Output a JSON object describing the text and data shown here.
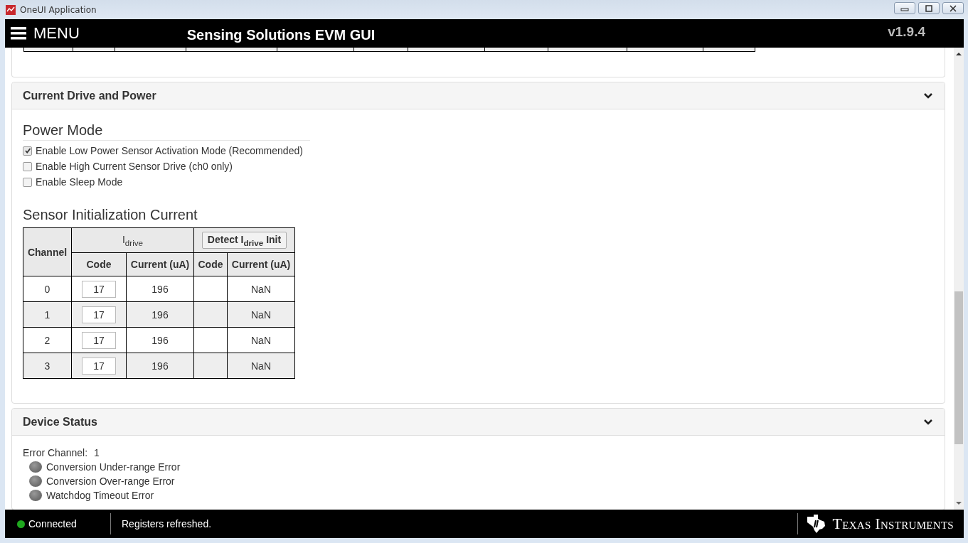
{
  "window": {
    "title": "OneUI Application"
  },
  "header": {
    "menu_label": "MENU",
    "title": "Sensing Solutions EVM GUI",
    "version": "v1.9.4"
  },
  "panels": [
    {
      "title": "Current Drive and Power",
      "expanded": true
    },
    {
      "title": "Device Status",
      "expanded": true
    }
  ],
  "power_mode": {
    "heading": "Power Mode",
    "options": [
      {
        "label": "Enable Low Power Sensor Activation Mode (Recommended)",
        "checked": true
      },
      {
        "label": "Enable High Current Sensor Drive (ch0 only)",
        "checked": false
      },
      {
        "label": "Enable Sleep Mode",
        "checked": false
      }
    ]
  },
  "init_current": {
    "heading": "Sensor Initialization Current",
    "channel_header": "Channel",
    "idrive_header": "I$_{drive}$",
    "detect_button": "Detect I$_{drive}$ Init",
    "columns": [
      "Code",
      "Current (uA)",
      "Code",
      "Current (uA)"
    ],
    "rows": [
      {
        "channel": "0",
        "code": "17",
        "current": "196",
        "detect_code": "",
        "detect_current": "NaN"
      },
      {
        "channel": "1",
        "code": "17",
        "current": "196",
        "detect_code": "",
        "detect_current": "NaN"
      },
      {
        "channel": "2",
        "code": "17",
        "current": "196",
        "detect_code": "",
        "detect_current": "NaN"
      },
      {
        "channel": "3",
        "code": "17",
        "current": "196",
        "detect_code": "",
        "detect_current": "NaN"
      }
    ]
  },
  "device_status": {
    "error_channel_label": "Error Channel:",
    "error_channel": "1",
    "flags": [
      {
        "label": "Conversion Under-range Error",
        "on": false
      },
      {
        "label": "Conversion Over-range Error",
        "on": false
      },
      {
        "label": "Watchdog Timeout Error",
        "on": false
      }
    ]
  },
  "status_bar": {
    "connected": true,
    "connection": "Connected",
    "message": "Registers refreshed.",
    "logo": "Texas Instruments"
  }
}
